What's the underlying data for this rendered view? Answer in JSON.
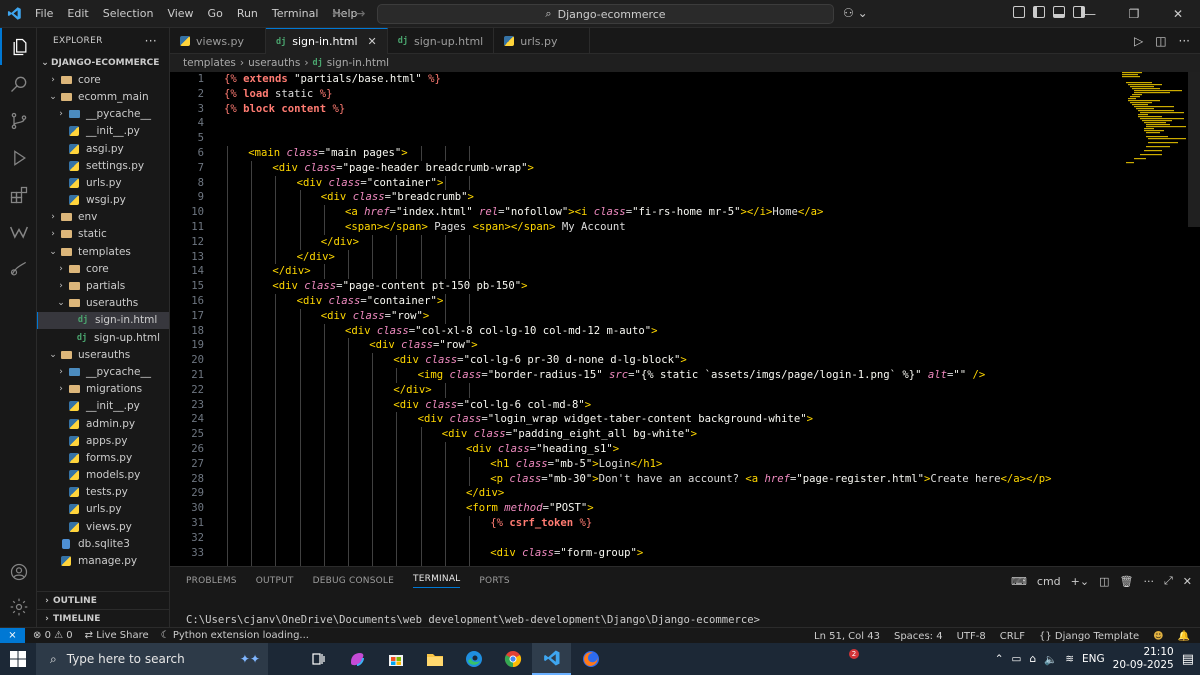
{
  "titlebar": {
    "menu": [
      "File",
      "Edit",
      "Selection",
      "View",
      "Go",
      "Run",
      "Terminal",
      "Help"
    ],
    "command_center": "Django-ecommerce"
  },
  "sidebar": {
    "header": "EXPLORER",
    "header_more": "···",
    "root": "DJANGO-ECOMMERCE",
    "tree": [
      {
        "label": "core",
        "depth": 1,
        "kind": "folder",
        "open": false
      },
      {
        "label": "ecomm_main",
        "depth": 1,
        "kind": "folder",
        "open": true
      },
      {
        "label": "__pycache__",
        "depth": 2,
        "kind": "pyfolder",
        "open": false
      },
      {
        "label": "__init__.py",
        "depth": 2,
        "kind": "py"
      },
      {
        "label": "asgi.py",
        "depth": 2,
        "kind": "py"
      },
      {
        "label": "settings.py",
        "depth": 2,
        "kind": "py"
      },
      {
        "label": "urls.py",
        "depth": 2,
        "kind": "py"
      },
      {
        "label": "wsgi.py",
        "depth": 2,
        "kind": "py"
      },
      {
        "label": "env",
        "depth": 1,
        "kind": "folder",
        "open": false
      },
      {
        "label": "static",
        "depth": 1,
        "kind": "folder",
        "open": false
      },
      {
        "label": "templates",
        "depth": 1,
        "kind": "folder",
        "open": true
      },
      {
        "label": "core",
        "depth": 2,
        "kind": "folder",
        "open": false
      },
      {
        "label": "partials",
        "depth": 2,
        "kind": "folder",
        "open": false
      },
      {
        "label": "userauths",
        "depth": 2,
        "kind": "folder",
        "open": true
      },
      {
        "label": "sign-in.html",
        "depth": 3,
        "kind": "dj",
        "selected": true
      },
      {
        "label": "sign-up.html",
        "depth": 3,
        "kind": "dj"
      },
      {
        "label": "userauths",
        "depth": 1,
        "kind": "folder",
        "open": true
      },
      {
        "label": "__pycache__",
        "depth": 2,
        "kind": "pyfolder",
        "open": false
      },
      {
        "label": "migrations",
        "depth": 2,
        "kind": "folder",
        "open": false
      },
      {
        "label": "__init__.py",
        "depth": 2,
        "kind": "py"
      },
      {
        "label": "admin.py",
        "depth": 2,
        "kind": "py"
      },
      {
        "label": "apps.py",
        "depth": 2,
        "kind": "py"
      },
      {
        "label": "forms.py",
        "depth": 2,
        "kind": "py"
      },
      {
        "label": "models.py",
        "depth": 2,
        "kind": "py"
      },
      {
        "label": "tests.py",
        "depth": 2,
        "kind": "py"
      },
      {
        "label": "urls.py",
        "depth": 2,
        "kind": "py"
      },
      {
        "label": "views.py",
        "depth": 2,
        "kind": "py"
      },
      {
        "label": "db.sqlite3",
        "depth": 1,
        "kind": "db"
      },
      {
        "label": "manage.py",
        "depth": 1,
        "kind": "py"
      }
    ],
    "outline": "OUTLINE",
    "timeline": "TIMELINE"
  },
  "tabs": [
    {
      "label": "views.py",
      "kind": "py",
      "active": false
    },
    {
      "label": "sign-in.html",
      "kind": "dj",
      "active": true
    },
    {
      "label": "sign-up.html",
      "kind": "dj",
      "active": false
    },
    {
      "label": "urls.py",
      "kind": "py",
      "active": false
    }
  ],
  "breadcrumb": [
    "templates",
    "userauths",
    "sign-in.html"
  ],
  "code_lines": [
    {
      "n": 1,
      "indent": 0,
      "tokens": [
        [
          "delim",
          "{%"
        ],
        [
          "kw",
          " extends "
        ],
        [
          "str",
          "\"partials/base.html\" "
        ],
        [
          "delim",
          "%}"
        ]
      ]
    },
    {
      "n": 2,
      "indent": 0,
      "tokens": [
        [
          "delim",
          "{%"
        ],
        [
          "kw",
          " load "
        ],
        [
          "text",
          "static "
        ],
        [
          "delim",
          "%}"
        ]
      ]
    },
    {
      "n": 3,
      "indent": 0,
      "tokens": [
        [
          "delim",
          "{%"
        ],
        [
          "kw",
          " block "
        ],
        [
          "kw",
          "content "
        ],
        [
          "delim",
          "%}"
        ]
      ]
    },
    {
      "n": 4,
      "indent": 0,
      "tokens": []
    },
    {
      "n": 5,
      "indent": 0,
      "tokens": []
    },
    {
      "n": 6,
      "indent": 1,
      "tokens": [
        [
          "tag",
          "<main "
        ],
        [
          "attr",
          "class"
        ],
        [
          "text",
          "="
        ],
        [
          "str",
          "\"main pages\""
        ],
        [
          "tag",
          ">"
        ]
      ]
    },
    {
      "n": 7,
      "indent": 2,
      "tokens": [
        [
          "tag",
          "<div "
        ],
        [
          "attr",
          "class"
        ],
        [
          "text",
          "="
        ],
        [
          "str",
          "\"page-header breadcrumb-wrap\""
        ],
        [
          "tag",
          ">"
        ]
      ]
    },
    {
      "n": 8,
      "indent": 3,
      "tokens": [
        [
          "tag",
          "<div "
        ],
        [
          "attr",
          "class"
        ],
        [
          "text",
          "="
        ],
        [
          "str",
          "\"container\""
        ],
        [
          "tag",
          ">"
        ]
      ]
    },
    {
      "n": 9,
      "indent": 4,
      "tokens": [
        [
          "tag",
          "<div "
        ],
        [
          "attr",
          "class"
        ],
        [
          "text",
          "="
        ],
        [
          "str",
          "\"breadcrumb\""
        ],
        [
          "tag",
          ">"
        ]
      ]
    },
    {
      "n": 10,
      "indent": 5,
      "tokens": [
        [
          "tag",
          "<a "
        ],
        [
          "attr",
          "href"
        ],
        [
          "text",
          "="
        ],
        [
          "str",
          "\"index.html\" "
        ],
        [
          "attr",
          "rel"
        ],
        [
          "text",
          "="
        ],
        [
          "str",
          "\"nofollow\""
        ],
        [
          "tag",
          "><i "
        ],
        [
          "attr",
          "class"
        ],
        [
          "text",
          "="
        ],
        [
          "str",
          "\"fi-rs-home mr-5\""
        ],
        [
          "tag",
          "></i>"
        ],
        [
          "text",
          "Home"
        ],
        [
          "tag",
          "</a>"
        ]
      ]
    },
    {
      "n": 11,
      "indent": 5,
      "tokens": [
        [
          "tag",
          "<span></span>"
        ],
        [
          "text",
          " Pages "
        ],
        [
          "tag",
          "<span></span>"
        ],
        [
          "text",
          " My Account"
        ]
      ]
    },
    {
      "n": 12,
      "indent": 4,
      "tokens": [
        [
          "tag",
          "</div>"
        ]
      ]
    },
    {
      "n": 13,
      "indent": 3,
      "tokens": [
        [
          "tag",
          "</div>"
        ]
      ]
    },
    {
      "n": 14,
      "indent": 2,
      "tokens": [
        [
          "tag",
          "</div>"
        ]
      ]
    },
    {
      "n": 15,
      "indent": 2,
      "tokens": [
        [
          "tag",
          "<div "
        ],
        [
          "attr",
          "class"
        ],
        [
          "text",
          "="
        ],
        [
          "str",
          "\"page-content pt-150 pb-150\""
        ],
        [
          "tag",
          ">"
        ]
      ]
    },
    {
      "n": 16,
      "indent": 3,
      "tokens": [
        [
          "tag",
          "<div "
        ],
        [
          "attr",
          "class"
        ],
        [
          "text",
          "="
        ],
        [
          "str",
          "\"container\""
        ],
        [
          "tag",
          ">"
        ]
      ]
    },
    {
      "n": 17,
      "indent": 4,
      "tokens": [
        [
          "tag",
          "<div "
        ],
        [
          "attr",
          "class"
        ],
        [
          "text",
          "="
        ],
        [
          "str",
          "\"row\""
        ],
        [
          "tag",
          ">"
        ]
      ]
    },
    {
      "n": 18,
      "indent": 5,
      "tokens": [
        [
          "tag",
          "<div "
        ],
        [
          "attr",
          "class"
        ],
        [
          "text",
          "="
        ],
        [
          "str",
          "\"col-xl-8 col-lg-10 col-md-12 m-auto\""
        ],
        [
          "tag",
          ">"
        ]
      ]
    },
    {
      "n": 19,
      "indent": 6,
      "tokens": [
        [
          "tag",
          "<div "
        ],
        [
          "attr",
          "class"
        ],
        [
          "text",
          "="
        ],
        [
          "str",
          "\"row\""
        ],
        [
          "tag",
          ">"
        ]
      ]
    },
    {
      "n": 20,
      "indent": 7,
      "tokens": [
        [
          "tag",
          "<div "
        ],
        [
          "attr",
          "class"
        ],
        [
          "text",
          "="
        ],
        [
          "str",
          "\"col-lg-6 pr-30 d-none d-lg-block\""
        ],
        [
          "tag",
          ">"
        ]
      ]
    },
    {
      "n": 21,
      "indent": 8,
      "tokens": [
        [
          "tag",
          "<img "
        ],
        [
          "attr",
          "class"
        ],
        [
          "text",
          "="
        ],
        [
          "str",
          "\"border-radius-15\" "
        ],
        [
          "attr",
          "src"
        ],
        [
          "text",
          "="
        ],
        [
          "str",
          "\"{% static `assets/imgs/page/login-1.png` %}\" "
        ],
        [
          "attr",
          "alt"
        ],
        [
          "text",
          "="
        ],
        [
          "str",
          "\"\" "
        ],
        [
          "tag",
          "/>"
        ]
      ]
    },
    {
      "n": 22,
      "indent": 7,
      "tokens": [
        [
          "tag",
          "</div>"
        ]
      ]
    },
    {
      "n": 23,
      "indent": 7,
      "tokens": [
        [
          "tag",
          "<div "
        ],
        [
          "attr",
          "class"
        ],
        [
          "text",
          "="
        ],
        [
          "str",
          "\"col-lg-6 col-md-8\""
        ],
        [
          "tag",
          ">"
        ]
      ]
    },
    {
      "n": 24,
      "indent": 8,
      "tokens": [
        [
          "tag",
          "<div "
        ],
        [
          "attr",
          "class"
        ],
        [
          "text",
          "="
        ],
        [
          "str",
          "\"login_wrap widget-taber-content background-white\""
        ],
        [
          "tag",
          ">"
        ]
      ]
    },
    {
      "n": 25,
      "indent": 9,
      "tokens": [
        [
          "tag",
          "<div "
        ],
        [
          "attr",
          "class"
        ],
        [
          "text",
          "="
        ],
        [
          "str",
          "\"padding_eight_all bg-white\""
        ],
        [
          "tag",
          ">"
        ]
      ]
    },
    {
      "n": 26,
      "indent": 10,
      "tokens": [
        [
          "tag",
          "<div "
        ],
        [
          "attr",
          "class"
        ],
        [
          "text",
          "="
        ],
        [
          "str",
          "\"heading_s1\""
        ],
        [
          "tag",
          ">"
        ]
      ]
    },
    {
      "n": 27,
      "indent": 11,
      "tokens": [
        [
          "tag",
          "<h1 "
        ],
        [
          "attr",
          "class"
        ],
        [
          "text",
          "="
        ],
        [
          "str",
          "\"mb-5\""
        ],
        [
          "tag",
          ">"
        ],
        [
          "text",
          "Login"
        ],
        [
          "tag",
          "</h1>"
        ]
      ]
    },
    {
      "n": 28,
      "indent": 11,
      "tokens": [
        [
          "tag",
          "<p "
        ],
        [
          "attr",
          "class"
        ],
        [
          "text",
          "="
        ],
        [
          "str",
          "\"mb-30\""
        ],
        [
          "tag",
          ">"
        ],
        [
          "text",
          "Don't have an account? "
        ],
        [
          "tag",
          "<a "
        ],
        [
          "attr",
          "href"
        ],
        [
          "text",
          "="
        ],
        [
          "str",
          "\"page-register.html\""
        ],
        [
          "tag",
          ">"
        ],
        [
          "text",
          "Create here"
        ],
        [
          "tag",
          "</a></p>"
        ]
      ]
    },
    {
      "n": 29,
      "indent": 10,
      "tokens": [
        [
          "tag",
          "</div>"
        ]
      ]
    },
    {
      "n": 30,
      "indent": 10,
      "tokens": [
        [
          "tag",
          "<form "
        ],
        [
          "attr",
          "method"
        ],
        [
          "text",
          "="
        ],
        [
          "str",
          "\"POST\""
        ],
        [
          "tag",
          ">"
        ]
      ]
    },
    {
      "n": 31,
      "indent": 11,
      "tokens": [
        [
          "delim",
          "{%"
        ],
        [
          "kw",
          " csrf_token "
        ],
        [
          "delim",
          "%}"
        ]
      ]
    },
    {
      "n": 32,
      "indent": 0,
      "tokens": []
    },
    {
      "n": 33,
      "indent": 11,
      "tokens": [
        [
          "tag",
          "<div "
        ],
        [
          "attr",
          "class"
        ],
        [
          "text",
          "="
        ],
        [
          "str",
          "\"form-group\""
        ],
        [
          "tag",
          ">"
        ]
      ]
    }
  ],
  "panel": {
    "tabs": [
      "PROBLEMS",
      "OUTPUT",
      "DEBUG CONSOLE",
      "TERMINAL",
      "PORTS"
    ],
    "active_tab": "TERMINAL",
    "shell": "cmd",
    "terminal_text": "C:\\Users\\cjanv\\OneDrive\\Documents\\web development\\web-development\\Django\\Django-ecommerce>"
  },
  "statusbar": {
    "errors": "0",
    "warnings": "0",
    "live_share": "Live Share",
    "python_status": "Python extension loading...",
    "cursor": "Ln 51, Col 43",
    "spaces": "Spaces: 4",
    "encoding": "UTF-8",
    "eol": "CRLF",
    "language": "Django Template"
  },
  "taskbar": {
    "search_placeholder": "Type here to search",
    "time": "21:10",
    "date": "20-09-2025",
    "lang": "ENG",
    "notif_badge": "2"
  },
  "colors": {
    "accent": "#0078d4",
    "tag": "#ffd700",
    "attr": "#f08bc0",
    "template_delim": "#ff7b72",
    "editor_bg": "#000000"
  }
}
